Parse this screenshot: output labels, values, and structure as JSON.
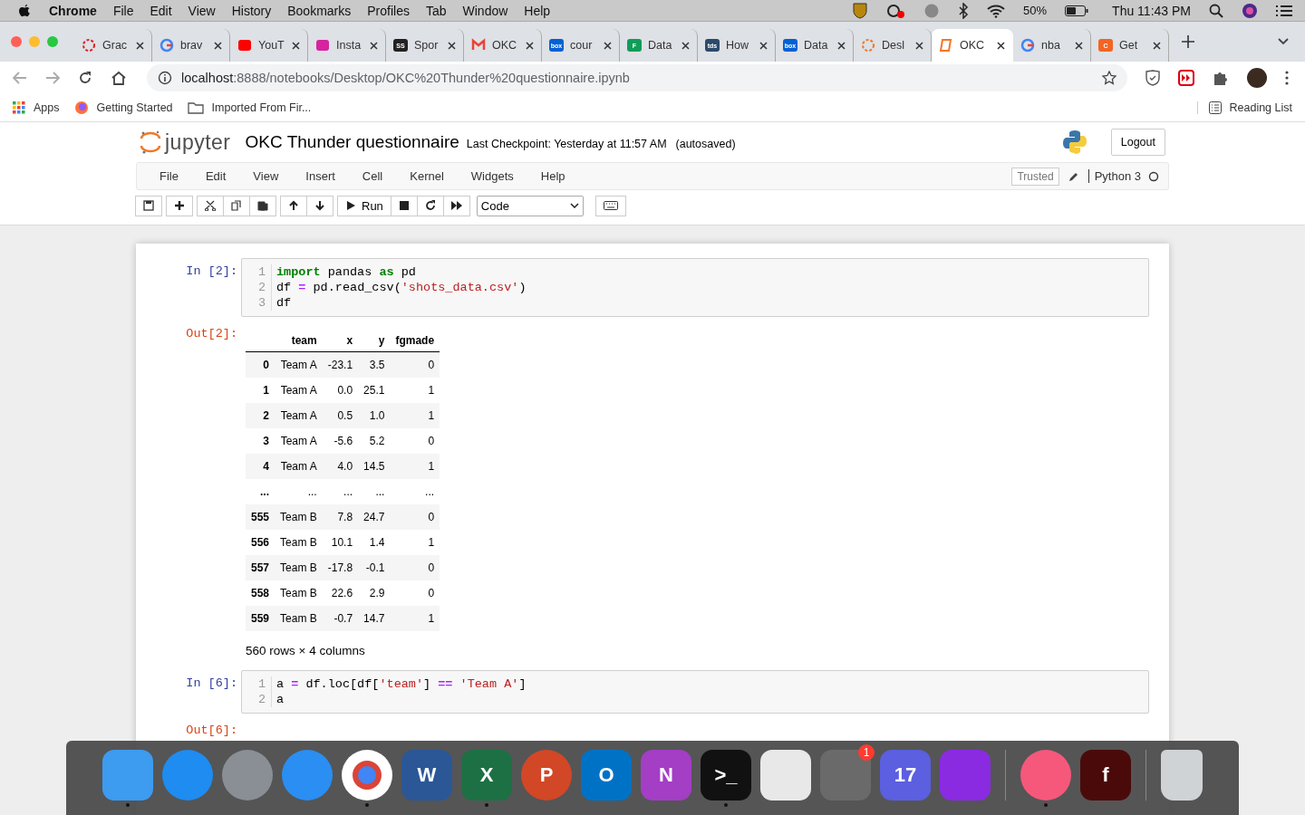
{
  "menubar": {
    "app_name": "Chrome",
    "menus": [
      "File",
      "Edit",
      "View",
      "History",
      "Bookmarks",
      "Profiles",
      "Tab",
      "Window",
      "Help"
    ],
    "battery": "50%",
    "clock": "Thu 11:43 PM"
  },
  "tabs": [
    {
      "title": "Grac",
      "icon": {
        "kind": "ring",
        "color": "#e02020"
      },
      "selected": false
    },
    {
      "title": "brav",
      "icon": {
        "kind": "g",
        "color": "#4285f4"
      },
      "selected": false
    },
    {
      "title": "YouT",
      "icon": {
        "kind": "square",
        "color": "#ff0000"
      },
      "selected": false
    },
    {
      "title": "Insta",
      "icon": {
        "kind": "square",
        "color": "#d6249f"
      },
      "selected": false
    },
    {
      "title": "Spor",
      "icon": {
        "kind": "square",
        "color": "#222222",
        "glyph": "SS"
      },
      "selected": false
    },
    {
      "title": "OKC",
      "icon": {
        "kind": "m",
        "color": "#ea4335"
      },
      "selected": false
    },
    {
      "title": "cour",
      "icon": {
        "kind": "square",
        "color": "#0061d5",
        "glyph": "box"
      },
      "selected": false
    },
    {
      "title": "Data",
      "icon": {
        "kind": "square",
        "color": "#0f9d58",
        "glyph": "F"
      },
      "selected": false
    },
    {
      "title": "How",
      "icon": {
        "kind": "square",
        "color": "#2c4a6b",
        "glyph": "tds"
      },
      "selected": false
    },
    {
      "title": "Data",
      "icon": {
        "kind": "square",
        "color": "#0061d5",
        "glyph": "box"
      },
      "selected": false
    },
    {
      "title": "Desl",
      "icon": {
        "kind": "ring",
        "color": "#f37626"
      },
      "selected": false
    },
    {
      "title": "OKC",
      "icon": {
        "kind": "book",
        "color": "#f37626"
      },
      "selected": true
    },
    {
      "title": "nba",
      "icon": {
        "kind": "g",
        "color": "#4285f4"
      },
      "selected": false
    },
    {
      "title": "Get",
      "icon": {
        "kind": "square",
        "color": "#f26522",
        "glyph": "C"
      },
      "selected": false
    }
  ],
  "address": {
    "host": "localhost",
    "path": ":8888/notebooks/Desktop/OKC%20Thunder%20questionnaire.ipynb"
  },
  "bookmarks": [
    {
      "label": "Apps",
      "kind": "apps"
    },
    {
      "label": "Getting Started",
      "kind": "firefox"
    },
    {
      "label": "Imported From Fir...",
      "kind": "folder"
    }
  ],
  "reading_list": "Reading List",
  "jupyter": {
    "logo": "jupyter",
    "title": "OKC Thunder questionnaire",
    "checkpoint": "Last Checkpoint: Yesterday at 11:57 AM",
    "autosaved": "(autosaved)",
    "logout": "Logout",
    "menus": [
      "File",
      "Edit",
      "View",
      "Insert",
      "Cell",
      "Kernel",
      "Widgets",
      "Help"
    ],
    "trusted": "Trusted",
    "kernel": "Python 3",
    "toolbar": [
      [
        {
          "kind": "save"
        }
      ],
      [
        {
          "kind": "add"
        }
      ],
      [
        {
          "kind": "cut"
        },
        {
          "kind": "copy"
        },
        {
          "kind": "paste"
        }
      ],
      [
        {
          "kind": "up"
        },
        {
          "kind": "down"
        }
      ],
      [
        {
          "kind": "run",
          "label": "Run"
        },
        {
          "kind": "stop"
        },
        {
          "kind": "restart"
        },
        {
          "kind": "fastforward"
        }
      ]
    ],
    "cell_type": "Code"
  },
  "cells": [
    {
      "prompt_in": "In [2]:",
      "lines": [
        {
          "n": "1",
          "tokens": [
            {
              "t": "import",
              "kind": "kw"
            },
            {
              "t": " pandas ",
              "kind": "plain"
            },
            {
              "t": "as",
              "kind": "kw"
            },
            {
              "t": " pd",
              "kind": "plain"
            }
          ]
        },
        {
          "n": "2",
          "tokens": [
            {
              "t": "df ",
              "kind": "plain"
            },
            {
              "t": "=",
              "kind": "op"
            },
            {
              "t": " pd.read_csv(",
              "kind": "plain"
            },
            {
              "t": "'shots_data.csv'",
              "kind": "str"
            },
            {
              "t": ")",
              "kind": "plain"
            }
          ]
        },
        {
          "n": "3",
          "tokens": [
            {
              "t": "df",
              "kind": "plain"
            }
          ]
        }
      ],
      "prompt_out": "Out[2]:",
      "table": {
        "columns": [
          null,
          "team",
          "x",
          "y",
          "fgmade"
        ],
        "rows": [
          [
            "0",
            "Team A",
            "-23.1",
            "3.5",
            "0"
          ],
          [
            "1",
            "Team A",
            "0.0",
            "25.1",
            "1"
          ],
          [
            "2",
            "Team A",
            "0.5",
            "1.0",
            "1"
          ],
          [
            "3",
            "Team A",
            "-5.6",
            "5.2",
            "0"
          ],
          [
            "4",
            "Team A",
            "4.0",
            "14.5",
            "1"
          ],
          [
            "...",
            "...",
            "...",
            "...",
            "..."
          ],
          [
            "555",
            "Team B",
            "7.8",
            "24.7",
            "0"
          ],
          [
            "556",
            "Team B",
            "10.1",
            "1.4",
            "1"
          ],
          [
            "557",
            "Team B",
            "-17.8",
            "-0.1",
            "0"
          ],
          [
            "558",
            "Team B",
            "22.6",
            "2.9",
            "0"
          ],
          [
            "559",
            "Team B",
            "-0.7",
            "14.7",
            "1"
          ]
        ],
        "summary": "560 rows × 4 columns"
      }
    },
    {
      "prompt_in": "In [6]:",
      "lines": [
        {
          "n": "1",
          "tokens": [
            {
              "t": "a ",
              "kind": "plain"
            },
            {
              "t": "=",
              "kind": "op"
            },
            {
              "t": " df.loc[df[",
              "kind": "plain"
            },
            {
              "t": "'team'",
              "kind": "str"
            },
            {
              "t": "] ",
              "kind": "plain"
            },
            {
              "t": "==",
              "kind": "op"
            },
            {
              "t": " 'Team A'",
              "kind": "str"
            },
            {
              "t": "]",
              "kind": "plain"
            }
          ]
        },
        {
          "n": "2",
          "tokens": [
            {
              "t": "a",
              "kind": "plain"
            }
          ]
        }
      ],
      "prompt_out": "Out[6]:"
    }
  ],
  "dock": [
    {
      "kind": "square",
      "color": "#3d9bf0",
      "running": true
    },
    {
      "kind": "circle",
      "color": "#1e8cf0",
      "running": false
    },
    {
      "kind": "circle",
      "color": "#8a8f96",
      "running": false
    },
    {
      "kind": "circle",
      "color": "#2a8ef2",
      "running": false
    },
    {
      "kind": "chrome",
      "color": "#ffffff",
      "running": true
    },
    {
      "kind": "square",
      "color": "#2b5797",
      "glyph": "W",
      "running": false
    },
    {
      "kind": "square",
      "color": "#1d7044",
      "glyph": "X",
      "running": true
    },
    {
      "kind": "circle",
      "color": "#d24726",
      "glyph": "P",
      "running": false
    },
    {
      "kind": "square",
      "color": "#0072c6",
      "glyph": "O",
      "running": false
    },
    {
      "kind": "square",
      "color": "#a33ec5",
      "glyph": "N",
      "running": false
    },
    {
      "kind": "square",
      "color": "#111111",
      "glyph": ">_",
      "running": true
    },
    {
      "kind": "square",
      "color": "#e8e8e8",
      "running": false
    },
    {
      "kind": "square",
      "color": "#6a6a6a",
      "badge": "1",
      "running": false
    },
    {
      "kind": "square",
      "color": "#5b5fe0",
      "glyph": "17",
      "running": false
    },
    {
      "kind": "square",
      "color": "#8a2be2",
      "running": false
    },
    {
      "kind": "sep"
    },
    {
      "kind": "circle",
      "color": "#f5587b",
      "running": true
    },
    {
      "kind": "square",
      "color": "#4a0a0a",
      "glyph": "f",
      "running": false
    },
    {
      "kind": "sep"
    },
    {
      "kind": "trash",
      "color": "#cfd3d6",
      "running": false
    }
  ]
}
